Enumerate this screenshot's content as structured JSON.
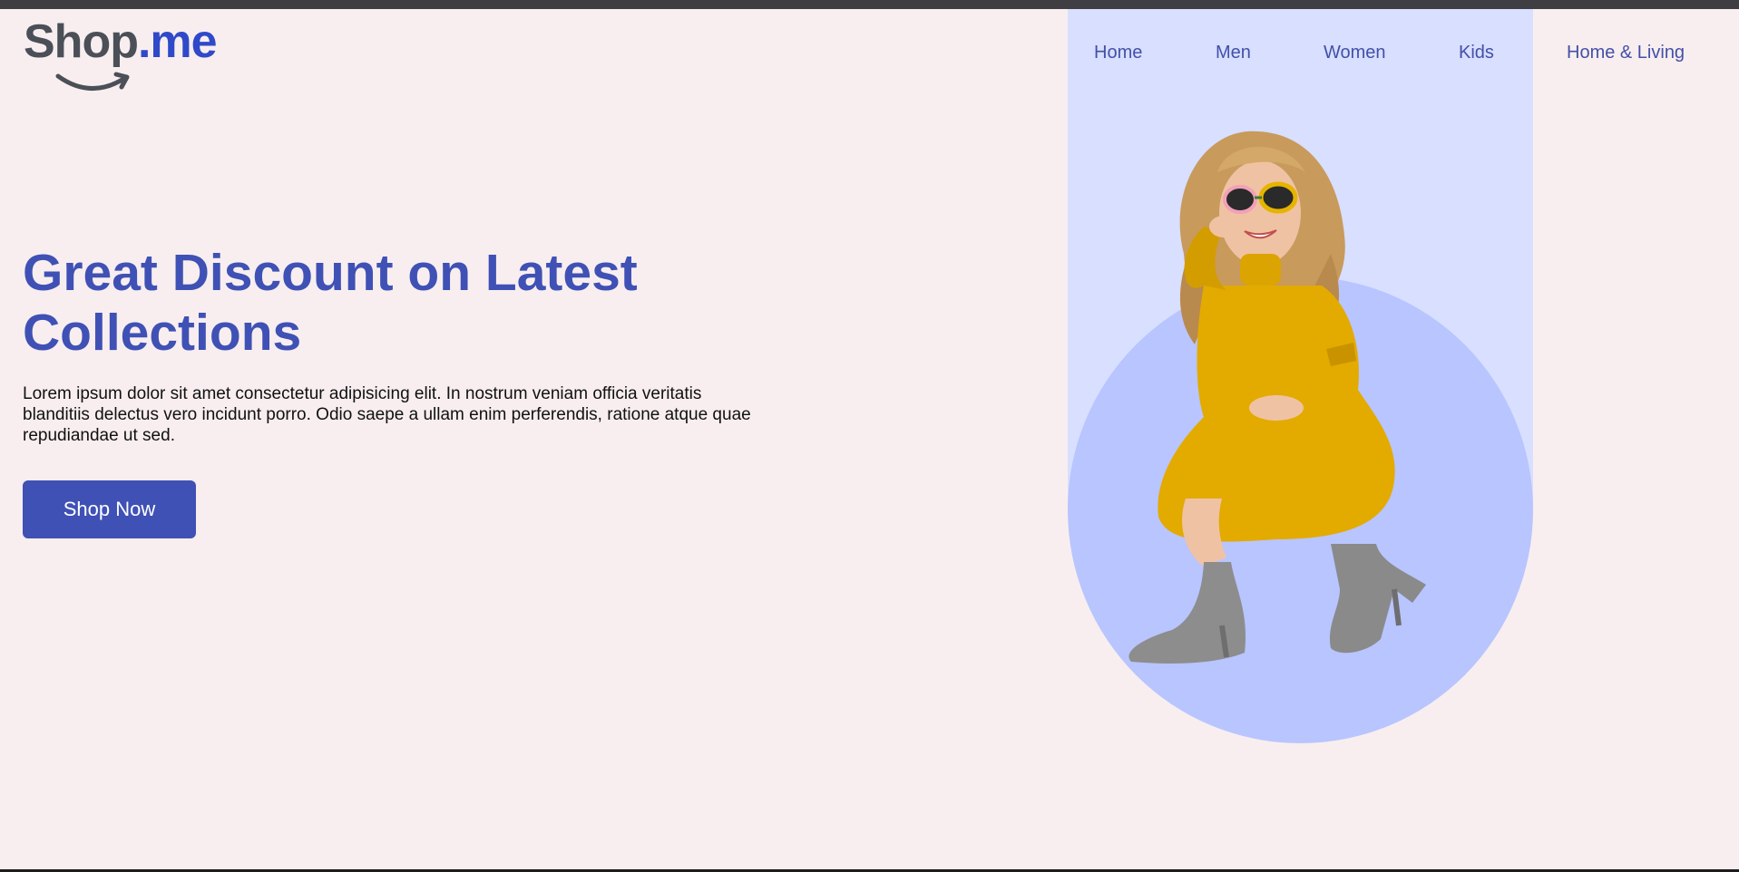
{
  "brand": {
    "name_part1": "Shop",
    "name_part2": ".me",
    "icon": "smile-arrow-icon"
  },
  "nav": {
    "items": [
      {
        "label": "Home"
      },
      {
        "label": "Men"
      },
      {
        "label": "Women"
      },
      {
        "label": "Kids"
      },
      {
        "label": "Home & Living"
      }
    ]
  },
  "hero": {
    "headline": "Great Discount on Latest Collections",
    "description": "Lorem ipsum dolor sit amet consectetur adipisicing elit. In nostrum veniam officia veritatis blanditiis delectus vero incidunt porro. Odio saepe a ullam enim perferendis, ratione atque quae repudiandae ut sed.",
    "cta_label": "Shop Now",
    "image_icon": "model-photo"
  },
  "colors": {
    "page_background": "#f8eeef",
    "accent": "#3f51b5",
    "nav_text": "#4350a8",
    "logo_dark": "#4b4f57",
    "logo_blue": "#2f49c9",
    "hero_panel": "#d8dfff",
    "hero_circle": "#b8c5fe",
    "dress_yellow": "#e3aa00"
  }
}
